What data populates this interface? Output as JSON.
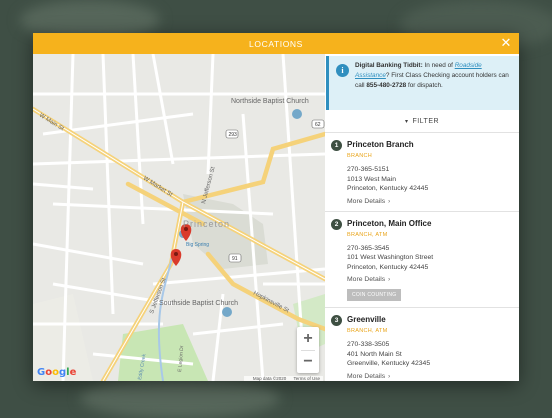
{
  "modal": {
    "title": "LOCATIONS",
    "close_icon": "close-icon"
  },
  "tidbit": {
    "bold": "Digital Banking Tidbit:",
    "text1": " In need of ",
    "link": "Roadside Assistance",
    "text2": "? First Class Checking account holders can call ",
    "phone": "855-480-2728",
    "text3": " for dispatch."
  },
  "filter": {
    "label": "FILTER"
  },
  "locations": [
    {
      "num": "1",
      "name": "Princeton Branch",
      "type": "BRANCH",
      "phone": "270-365-5151",
      "address1": "1013 West Main",
      "address2": "Princeton, Kentucky 42445",
      "more": "More Details"
    },
    {
      "num": "2",
      "name": "Princeton, Main Office",
      "type": "BRANCH, ATM",
      "phone": "270-365-3545",
      "address1": "101 West Washington Street",
      "address2": "Princeton, Kentucky 42445",
      "more": "More Details",
      "badge": "COIN COUNTING"
    },
    {
      "num": "3",
      "name": "Greenville",
      "type": "BRANCH, ATM",
      "phone": "270-338-3505",
      "address1": "401 North Main St",
      "address2": "Greenville, Kentucky 42345",
      "more": "More Details"
    }
  ],
  "map": {
    "labels": {
      "northside": "Northside Baptist Church",
      "southside": "Southside Baptist Church",
      "w_main": "W Main St",
      "w_market": "W Market St",
      "n_jefferson": "N Jefferson St",
      "s_jefferson": "S Jefferson St",
      "hopkinsville": "Hopkinsville St",
      "big_spring": "Big Spring",
      "princeton": "Princeton",
      "e_legion": "E Legion Dr",
      "eddy": "Eddy Creek",
      "shield_293": "293",
      "shield_62": "62",
      "shield_91": "91"
    },
    "zoom_in": "+",
    "zoom_out": "−",
    "google": [
      "G",
      "o",
      "o",
      "g",
      "l",
      "e"
    ],
    "google_colors": [
      "#4285f4",
      "#ea4335",
      "#fbbc05",
      "#4285f4",
      "#34a853",
      "#ea4335"
    ],
    "footer_data": "Map data ©2020",
    "footer_terms": "Terms of Use"
  },
  "colors": {
    "header": "#f6b21c",
    "accent": "#2f8fbf",
    "type": "#e9a419",
    "pin": "#d93a2b"
  }
}
